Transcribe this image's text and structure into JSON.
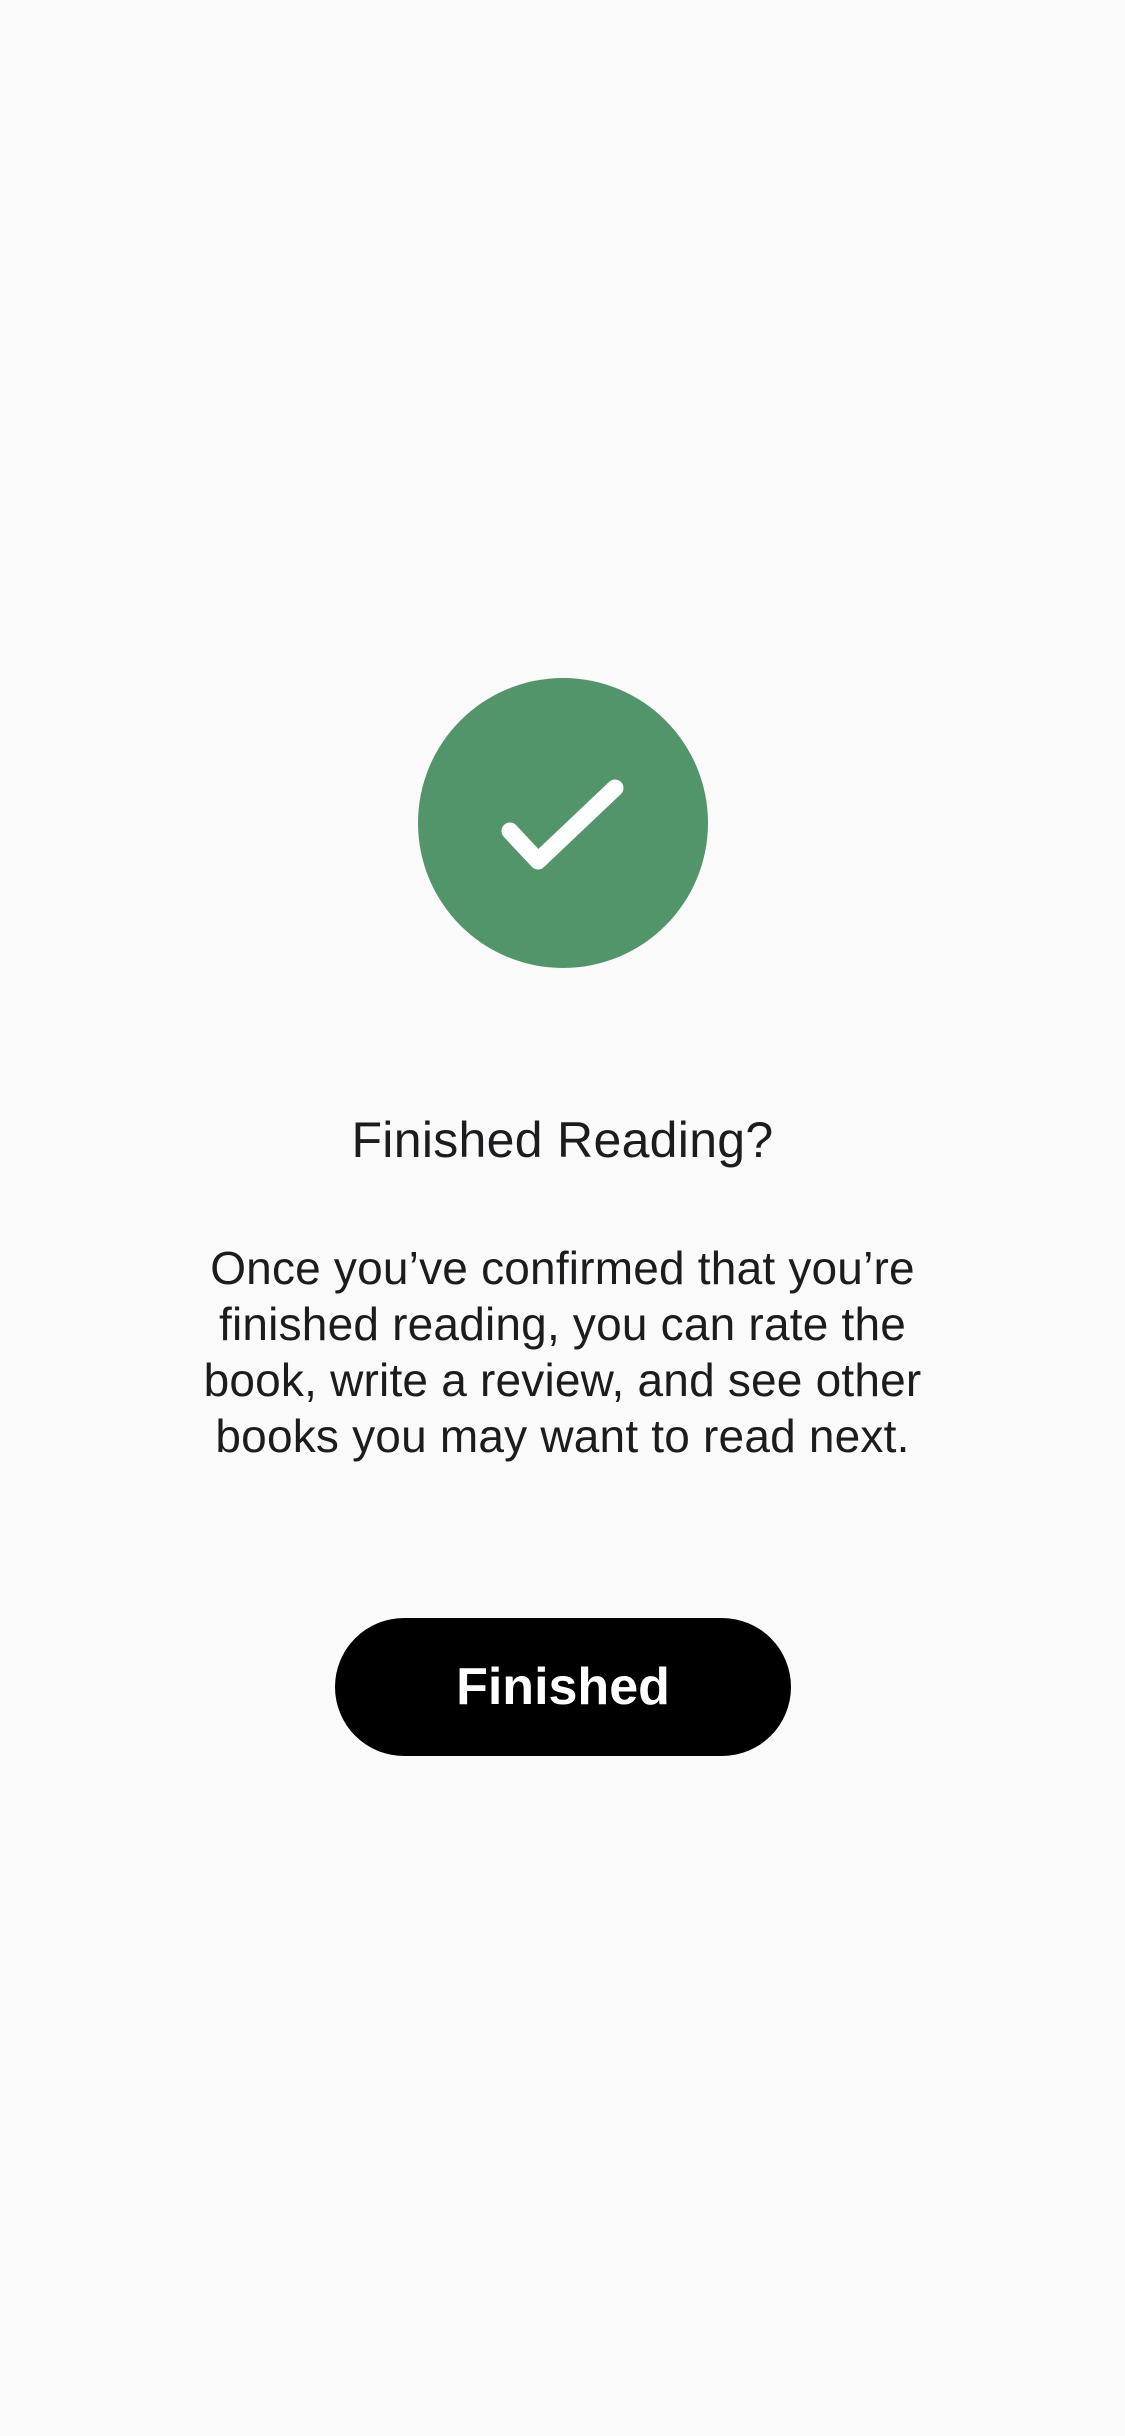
{
  "confirmation": {
    "icon": "checkmark-icon",
    "accent_color": "#53956a",
    "title": "Finished Reading?",
    "message": "Once you’ve confirmed that you’re finished reading, you can rate the book, write a review, and see other books you may want to read next.",
    "button_label": "Finished"
  }
}
